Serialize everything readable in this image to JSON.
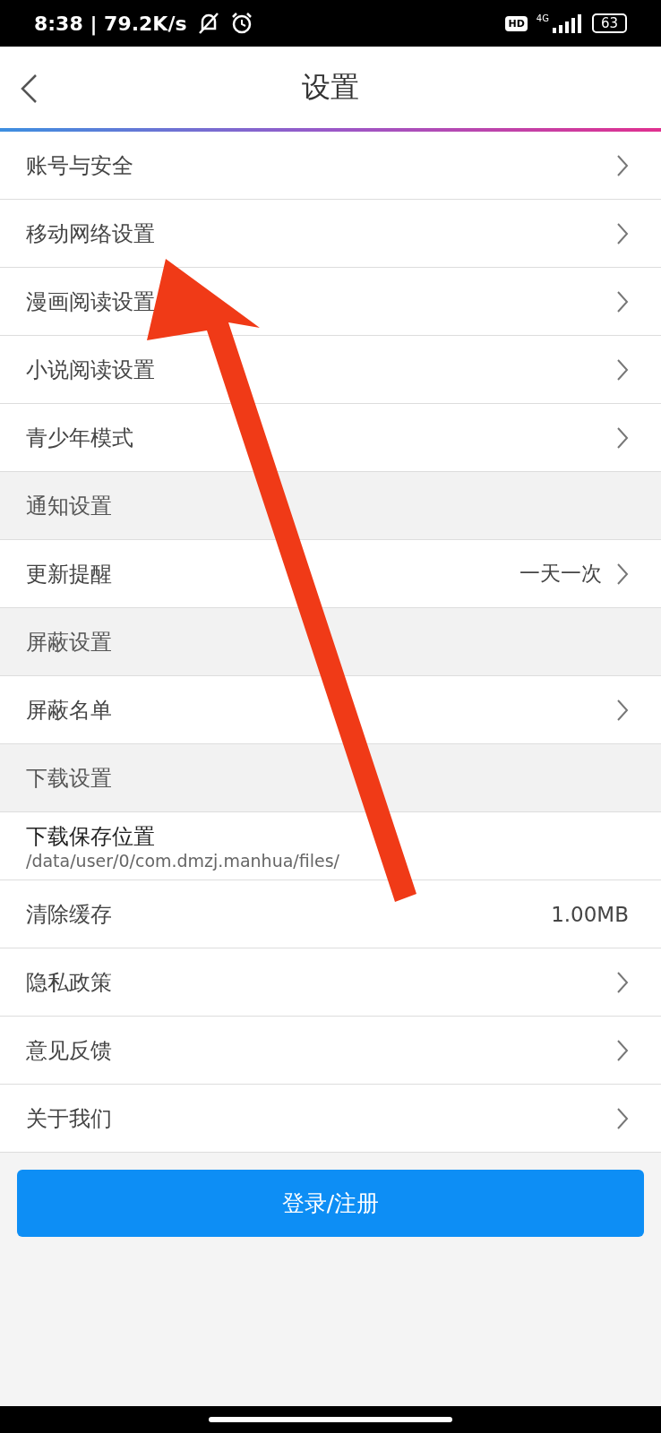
{
  "status_bar": {
    "time": "8:38 | 79.2K/s",
    "hd": "HD",
    "network": "4G",
    "battery": "63"
  },
  "header": {
    "title": "设置"
  },
  "rows": [
    {
      "kind": "link",
      "label": "账号与安全"
    },
    {
      "kind": "link",
      "label": "移动网络设置"
    },
    {
      "kind": "link",
      "label": "漫画阅读设置"
    },
    {
      "kind": "link",
      "label": "小说阅读设置"
    },
    {
      "kind": "link",
      "label": "青少年模式"
    },
    {
      "kind": "section",
      "label": "通知设置"
    },
    {
      "kind": "link",
      "label": "更新提醒",
      "value": "一天一次"
    },
    {
      "kind": "section",
      "label": "屏蔽设置"
    },
    {
      "kind": "link",
      "label": "屏蔽名单"
    },
    {
      "kind": "section",
      "label": "下载设置"
    },
    {
      "kind": "path",
      "label": "下载保存位置",
      "value": "/data/user/0/com.dmzj.manhua/files/"
    },
    {
      "kind": "value",
      "label": "清除缓存",
      "value": "1.00MB"
    },
    {
      "kind": "link",
      "label": "隐私政策"
    },
    {
      "kind": "link",
      "label": "意见反馈"
    },
    {
      "kind": "link",
      "label": "关于我们"
    }
  ],
  "login_button": "登录/注册",
  "annotation": {
    "kind": "arrow"
  }
}
